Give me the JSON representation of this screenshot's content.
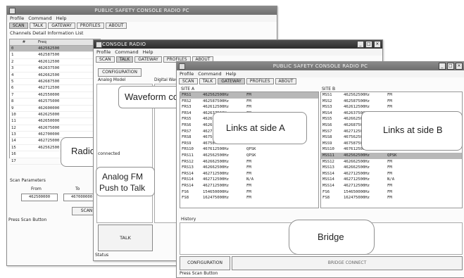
{
  "window1": {
    "title": "PUBLIC SAFETY CONSOLE RADIO PC",
    "menu": [
      "Profile",
      "Command",
      "Help"
    ],
    "tabs": [
      "SCAN",
      "TALK",
      "GATEWAY",
      "PROFILES",
      "ABOUT"
    ],
    "section": "Channels Detail Information List",
    "columns": [
      "#",
      "Freq"
    ],
    "rows": [
      [
        "0",
        "462562500"
      ],
      [
        "1",
        "462587500"
      ],
      [
        "2",
        "462612500"
      ],
      [
        "3",
        "462637500"
      ],
      [
        "4",
        "462662500"
      ],
      [
        "5",
        "462687500"
      ],
      [
        "6",
        "462712500"
      ],
      [
        "7",
        "462550000"
      ],
      [
        "8",
        "462575000"
      ],
      [
        "9",
        "462600000"
      ],
      [
        "10",
        "462625000"
      ],
      [
        "11",
        "462650000"
      ],
      [
        "12",
        "462675000"
      ],
      [
        "13",
        "462700000"
      ],
      [
        "14",
        "462725000"
      ],
      [
        "15",
        "462562500"
      ],
      [
        "16",
        ""
      ],
      [
        "17",
        ""
      ]
    ],
    "scan_params": "Scan Parameters",
    "from_label": "From",
    "from_value": "462500000",
    "to_label": "To",
    "to_value": "467000000",
    "scan_button": "SCAN",
    "status": "Press Scan Button"
  },
  "window2": {
    "title": "CONSOLE RADIO",
    "menu": [
      "Profile",
      "Command",
      "Help"
    ],
    "tabs": [
      "SCAN",
      "TALK",
      "GATEWAY",
      "PROFILES",
      "ABOUT"
    ],
    "config_button": "CONFIGURATION",
    "analog_label": "Analog Model",
    "digital_label": "Digital Wave",
    "connected": "connected",
    "talk_button": "TALK",
    "status": "Status"
  },
  "window3": {
    "title": "PUBLIC SAFETY CONSOLE RADIO PC",
    "menu": [
      "Profile",
      "Command",
      "Help"
    ],
    "tabs": [
      "SCAN",
      "TALK",
      "GATEWAY",
      "PROFILES",
      "ABOUT"
    ],
    "site_a_label": "SITE A",
    "site_b_label": "SITE B",
    "site_a": [
      [
        "FRS1",
        "462562500Hz",
        "FM"
      ],
      [
        "FRS2",
        "462587500Hz",
        "FM"
      ],
      [
        "FRS3",
        "462612500Hz",
        "FM"
      ],
      [
        "FRS4",
        "462637500Hz",
        "FM"
      ],
      [
        "FRS5",
        "462662500Hz",
        ""
      ],
      [
        "FRS6",
        "462687500Hz",
        ""
      ],
      [
        "FRS7",
        "462712500Hz",
        ""
      ],
      [
        "FRS8",
        "467562500Hz",
        ""
      ],
      [
        "FRS9",
        "467587500Hz",
        ""
      ],
      [
        "FRS10",
        "467612500Hz",
        "QPSK"
      ],
      [
        "FRS11",
        "462562500Hz",
        "QPSK"
      ],
      [
        "FRS12",
        "462662500Hz",
        "FM"
      ],
      [
        "FRS13",
        "462662500Hz",
        "FM"
      ],
      [
        "FRS14",
        "462712500Hz",
        "FM"
      ],
      [
        "FRS14",
        "462712500Hz",
        "N/A"
      ],
      [
        "FRS14",
        "462712500Hz",
        "FM"
      ],
      [
        "FS6",
        "154650000Hz",
        "FM"
      ],
      [
        "FS8",
        "162475000Hz",
        "FM"
      ]
    ],
    "site_b": [
      [
        "MSS1",
        "462562500Hz",
        "FM"
      ],
      [
        "MSS2",
        "462587500Hz",
        "FM"
      ],
      [
        "MSS3",
        "462612500Hz",
        "FM"
      ],
      [
        "MSS4",
        "462637500Hz",
        ""
      ],
      [
        "MSS5",
        "462662500Hz",
        ""
      ],
      [
        "MSS6",
        "462687500Hz",
        ""
      ],
      [
        "MSS7",
        "462712500Hz",
        ""
      ],
      [
        "MSS8",
        "467562500Hz",
        ""
      ],
      [
        "MSS9",
        "467587500Hz",
        ""
      ],
      [
        "MSS10",
        "467612500Hz",
        "QPSK"
      ],
      [
        "MSS11",
        "462562500Hz",
        "QPSK"
      ],
      [
        "MSS12",
        "462662500Hz",
        "FM"
      ],
      [
        "MSS13",
        "462662500Hz",
        "FM"
      ],
      [
        "MSS14",
        "462712500Hz",
        "FM"
      ],
      [
        "MSS14",
        "462712500Hz",
        "N/A"
      ],
      [
        "MSS14",
        "462712500Hz",
        "FM"
      ],
      [
        "FS6",
        "154650000Hz",
        "FM"
      ],
      [
        "FS8",
        "162475000Hz",
        "FM"
      ]
    ],
    "history_label": "History",
    "config_button": "CONFIGURATION",
    "bridge_button": "BRIDGE CONNECT",
    "status": "Press Scan Button"
  },
  "callouts": {
    "radio": "Radio",
    "waveform": "Waveform co",
    "analog_line1": "Analog FM",
    "analog_line2": "Push to Talk",
    "links_a": "Links at side A",
    "links_b": "Links at side B",
    "bridge": "Bridge"
  }
}
